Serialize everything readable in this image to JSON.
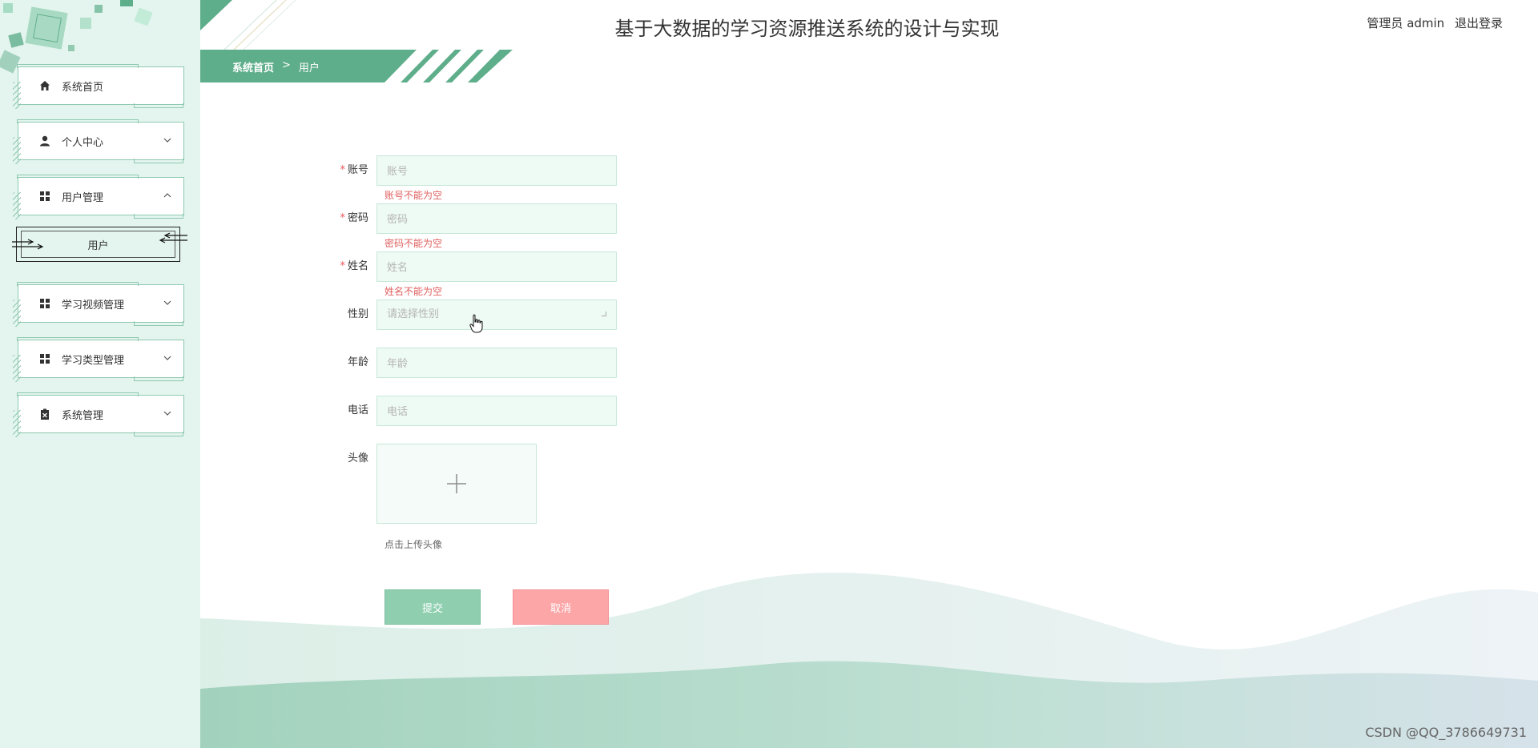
{
  "app": {
    "title": "基于大数据的学习资源推送系统的设计与实现"
  },
  "user": {
    "role_name": "管理员 admin",
    "logout_label": "退出登录"
  },
  "breadcrumb": {
    "home": "系统首页",
    "separator": ">",
    "current": "用户"
  },
  "sidebar": {
    "items": [
      {
        "label": "系统首页",
        "icon": "home-icon"
      },
      {
        "label": "个人中心",
        "icon": "user-icon",
        "expand": "chevron-down-icon"
      },
      {
        "label": "用户管理",
        "icon": "grid-icon",
        "expand": "chevron-up-icon"
      },
      {
        "label": "学习视频管理",
        "icon": "grid-icon",
        "expand": "chevron-down-icon"
      },
      {
        "label": "学习类型管理",
        "icon": "grid-icon",
        "expand": "chevron-down-icon"
      },
      {
        "label": "系统管理",
        "icon": "clipboard-icon",
        "expand": "chevron-down-icon"
      }
    ],
    "subitem": {
      "label": "用户"
    }
  },
  "form": {
    "account": {
      "label": "账号",
      "placeholder": "账号",
      "error": "账号不能为空",
      "required": true
    },
    "password": {
      "label": "密码",
      "placeholder": "密码",
      "error": "密码不能为空",
      "required": true
    },
    "name": {
      "label": "姓名",
      "placeholder": "姓名",
      "error": "姓名不能为空",
      "required": true
    },
    "gender": {
      "label": "性别",
      "placeholder": "请选择性别"
    },
    "age": {
      "label": "年龄",
      "placeholder": "年龄"
    },
    "phone": {
      "label": "电话",
      "placeholder": "电话"
    },
    "avatar": {
      "label": "头像",
      "tip": "点击上传头像"
    },
    "submit_label": "提交",
    "cancel_label": "取消"
  },
  "watermark": "CSDN @QQ_3786649731",
  "colors": {
    "accent": "#5fae8b",
    "sidebar_bg": "#e3f5ee",
    "cancel": "#fda6a8",
    "error": "#e06060"
  }
}
